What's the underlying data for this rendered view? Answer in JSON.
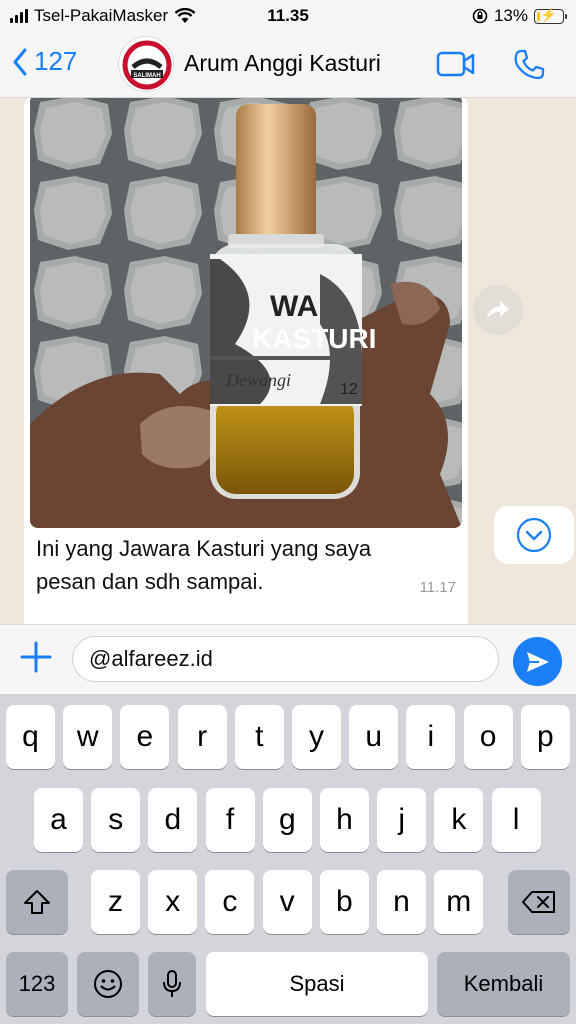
{
  "status_bar": {
    "carrier": "Tsel-PakaiMasker",
    "time": "11.35",
    "battery": "13%",
    "battery_level": 0.13
  },
  "header": {
    "back_count": "127",
    "contact_name": "Arum Anggi Kasturi",
    "avatar_text": "SALIMAH"
  },
  "message": {
    "text": "Ini yang Jawara Kasturi yang saya pesan dan sdh sampai.",
    "time": "11.17",
    "photo_label_line1": "WA",
    "photo_label_line2": "KASTURI",
    "photo_label_line3": "Dewangi",
    "photo_label_number": "12"
  },
  "input": {
    "value": "@alfareez.id"
  },
  "keyboard": {
    "row1": [
      "q",
      "w",
      "e",
      "r",
      "t",
      "y",
      "u",
      "i",
      "o",
      "p"
    ],
    "row2": [
      "a",
      "s",
      "d",
      "f",
      "g",
      "h",
      "j",
      "k",
      "l"
    ],
    "row3": [
      "z",
      "x",
      "c",
      "v",
      "b",
      "n",
      "m"
    ],
    "numbers_label": "123",
    "space_label": "Spasi",
    "return_label": "Kembali"
  },
  "colors": {
    "accent": "#1a7ef6",
    "chat_bg": "#efe7dc",
    "keyboard_bg": "#d3d5da"
  }
}
